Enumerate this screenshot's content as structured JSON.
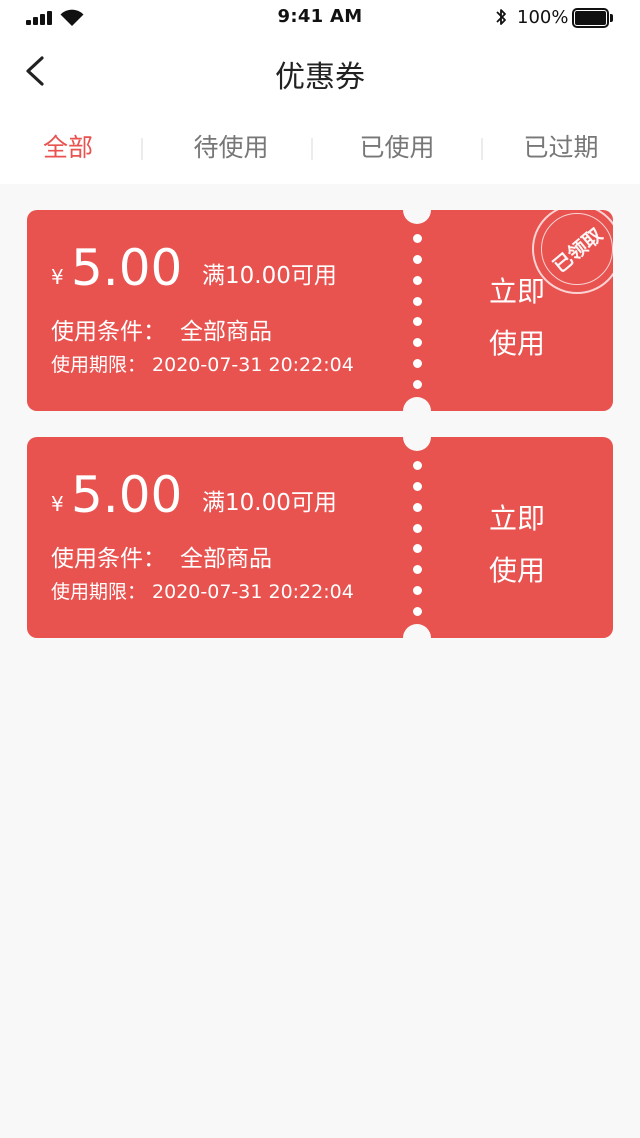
{
  "status_bar": {
    "time": "9:41 AM",
    "battery": "100%"
  },
  "nav": {
    "title": "优惠券"
  },
  "tabs": [
    {
      "label": "全部",
      "active": true
    },
    {
      "label": "待使用",
      "active": false
    },
    {
      "label": "已使用",
      "active": false
    },
    {
      "label": "已过期",
      "active": false
    }
  ],
  "coupons": [
    {
      "currency": "¥",
      "amount": "5.00",
      "threshold": "满10.00可用",
      "condition_label": "使用条件：",
      "condition_value": "全部商品",
      "period_label": "使用期限：",
      "period_value": "2020-07-31 20:22:04",
      "button_line1": "立即",
      "button_line2": "使用",
      "stamp": "已领取"
    },
    {
      "currency": "¥",
      "amount": "5.00",
      "threshold": "满10.00可用",
      "condition_label": "使用条件：",
      "condition_value": "全部商品",
      "period_label": "使用期限：",
      "period_value": "2020-07-31 20:22:04",
      "button_line1": "立即",
      "button_line2": "使用"
    }
  ],
  "colors": {
    "accent": "#e8524f",
    "background": "#f8f8f8"
  }
}
